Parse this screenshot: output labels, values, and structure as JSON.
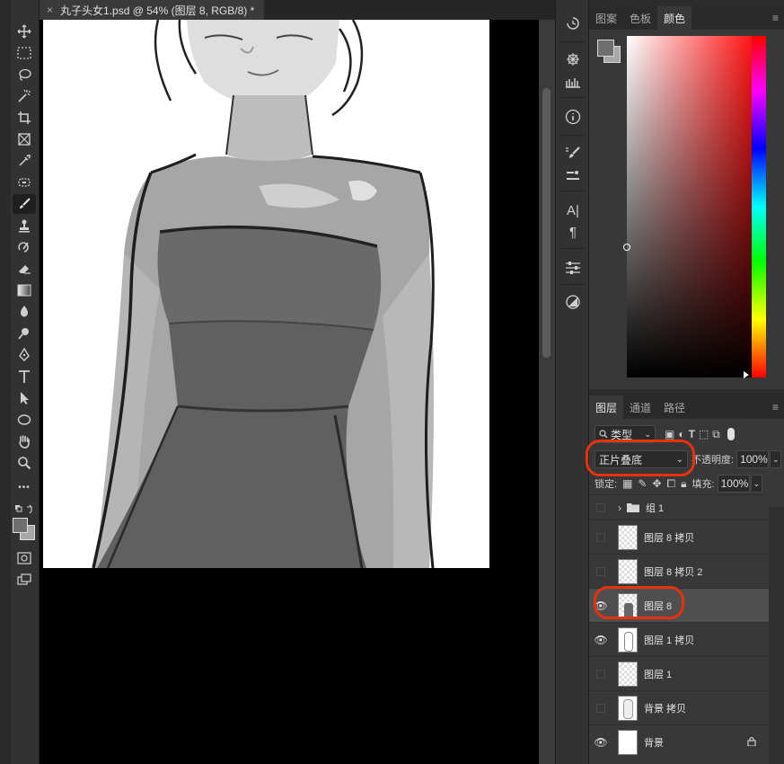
{
  "document": {
    "tab_title": "丸子头女1.psd @ 54% (图层 8, RGB/8) *",
    "close_glyph": "×"
  },
  "toolbar": {
    "tools": [
      {
        "name": "move-tool",
        "glyph": "✥"
      },
      {
        "name": "marquee-tool",
        "glyph": "⬚"
      },
      {
        "name": "lasso-tool",
        "glyph": "◯"
      },
      {
        "name": "magic-wand-tool",
        "glyph": "⁂"
      },
      {
        "name": "crop-tool",
        "glyph": "⌗"
      },
      {
        "name": "frame-tool",
        "glyph": "⊠"
      },
      {
        "name": "eyedropper-tool",
        "glyph": "⌿"
      },
      {
        "name": "healing-tool",
        "glyph": "⊕"
      },
      {
        "name": "brush-tool",
        "glyph": "✎",
        "active": true
      },
      {
        "name": "stamp-tool",
        "glyph": "⊥"
      },
      {
        "name": "history-brush-tool",
        "glyph": "⟳"
      },
      {
        "name": "eraser-tool",
        "glyph": "⌫"
      },
      {
        "name": "gradient-tool",
        "glyph": "▣"
      },
      {
        "name": "blur-tool",
        "glyph": "⬮"
      },
      {
        "name": "dodge-tool",
        "glyph": "⚲"
      },
      {
        "name": "pen-tool",
        "glyph": "✒"
      },
      {
        "name": "type-tool",
        "glyph": "T"
      },
      {
        "name": "path-select-tool",
        "glyph": "➤"
      },
      {
        "name": "ellipse-tool",
        "glyph": "⬭"
      },
      {
        "name": "hand-tool",
        "glyph": "✋"
      },
      {
        "name": "zoom-tool",
        "glyph": "⚲"
      },
      {
        "name": "more-tools",
        "glyph": "•••"
      }
    ]
  },
  "swatches": {
    "foreground": "#6f6f6f",
    "background": "#a8a8a8"
  },
  "color_panel": {
    "tabs": [
      "图案",
      "色板",
      "颜色"
    ],
    "active_tab": "颜色",
    "menu_glyph": "≡"
  },
  "layers_panel": {
    "tabs": [
      "图层",
      "通道",
      "路径"
    ],
    "active_tab": "图层",
    "menu_glyph": "≡",
    "filter_label": "类型",
    "blend_mode": "正片叠底",
    "opacity_label": "不透明度:",
    "opacity_value": "100%",
    "lock_label": "锁定:",
    "fill_label": "填充:",
    "fill_value": "100%",
    "layers": [
      {
        "name": "组 1",
        "type": "group",
        "visible": false
      },
      {
        "name": "图层 8 拷贝",
        "type": "pixel",
        "visible": false
      },
      {
        "name": "图层 8 拷贝 2",
        "type": "pixel",
        "visible": false
      },
      {
        "name": "图层 8",
        "type": "pixel",
        "visible": true,
        "selected": true
      },
      {
        "name": "图层 1 拷贝",
        "type": "pixel",
        "visible": true
      },
      {
        "name": "图层 1",
        "type": "pixel",
        "visible": false
      },
      {
        "name": "背景 拷贝",
        "type": "pixel",
        "visible": false
      },
      {
        "name": "背景",
        "type": "background",
        "visible": true,
        "locked": true
      }
    ]
  },
  "icons": {
    "eye": "👁",
    "lock": "🔒",
    "folder": "▬",
    "chevron": "›"
  }
}
